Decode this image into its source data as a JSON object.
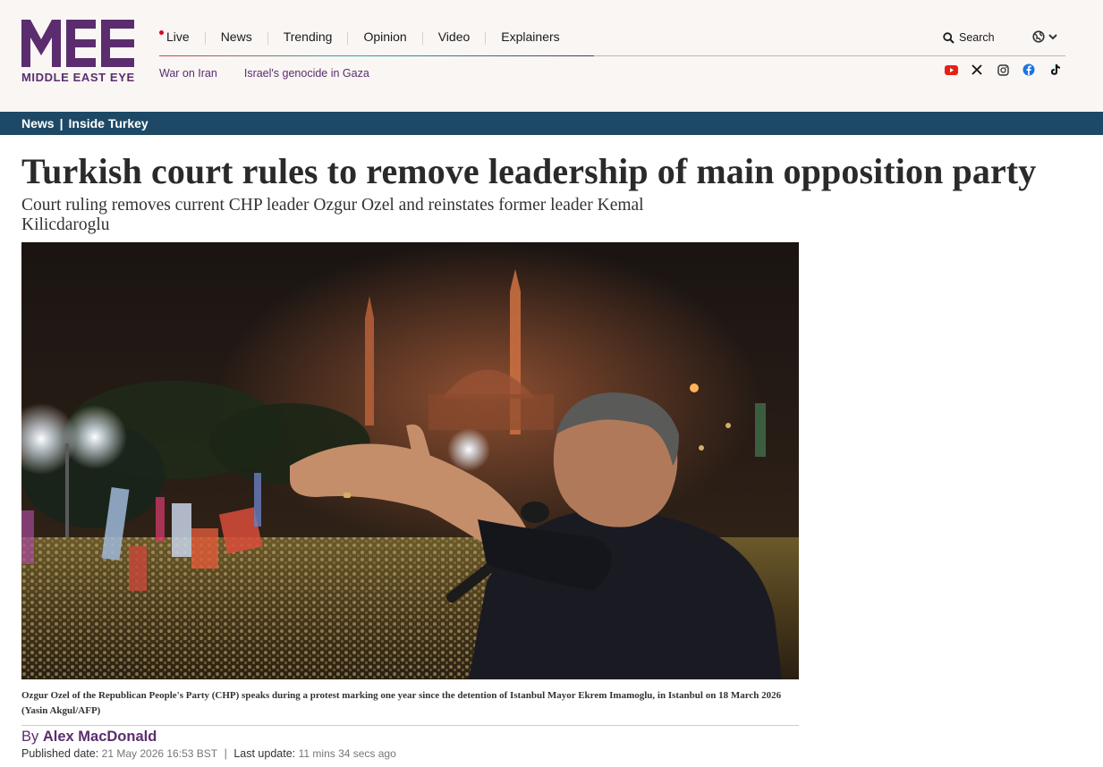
{
  "site": {
    "logo_mark": "MEE",
    "logo_name": "MIDDLE EAST EYE",
    "brand_color": "#5b2d6e",
    "live_dot_color": "#e0001b",
    "crumbbar_color": "#1d4966"
  },
  "nav": {
    "items": [
      "Live",
      "News",
      "Trending",
      "Opinion",
      "Video",
      "Explainers"
    ],
    "sub_items": [
      "War on Iran",
      "Israel's genocide in Gaza"
    ]
  },
  "search": {
    "label": "Search",
    "icon": "search-icon"
  },
  "language": {
    "icon": "globe-icon",
    "chevron": "chevron-down-icon"
  },
  "social": [
    {
      "name": "youtube-icon",
      "color": "#e62117"
    },
    {
      "name": "x-icon",
      "color": "#111111"
    },
    {
      "name": "instagram-icon",
      "color": "#333333"
    },
    {
      "name": "facebook-icon",
      "color": "#1b74e4"
    },
    {
      "name": "tiktok-icon",
      "color": "#111111"
    }
  ],
  "breadcrumb": {
    "section": "News",
    "separator": "|",
    "subsection": "Inside Turkey"
  },
  "article": {
    "headline": "Turkish court rules to remove leadership of main opposition party",
    "standfirst": "Court ruling removes current CHP leader Ozgur Ozel and reinstates former leader Kemal Kilicdaroglu",
    "caption": "Ozgur Ozel of the Republican People's Party (CHP) speaks during a protest marking one year since the detention of Istanbul Mayor Ekrem Imamoglu, in Istanbul on 18 March 2026 (Yasin Akgul/AFP)",
    "byline_prefix": "By",
    "author": "Alex MacDonald",
    "published_label": "Published date:",
    "published_value": "21 May 2026 16:53 BST",
    "date_separator": "|",
    "updated_label": "Last update:",
    "updated_value": "11 mins 34 secs ago"
  }
}
